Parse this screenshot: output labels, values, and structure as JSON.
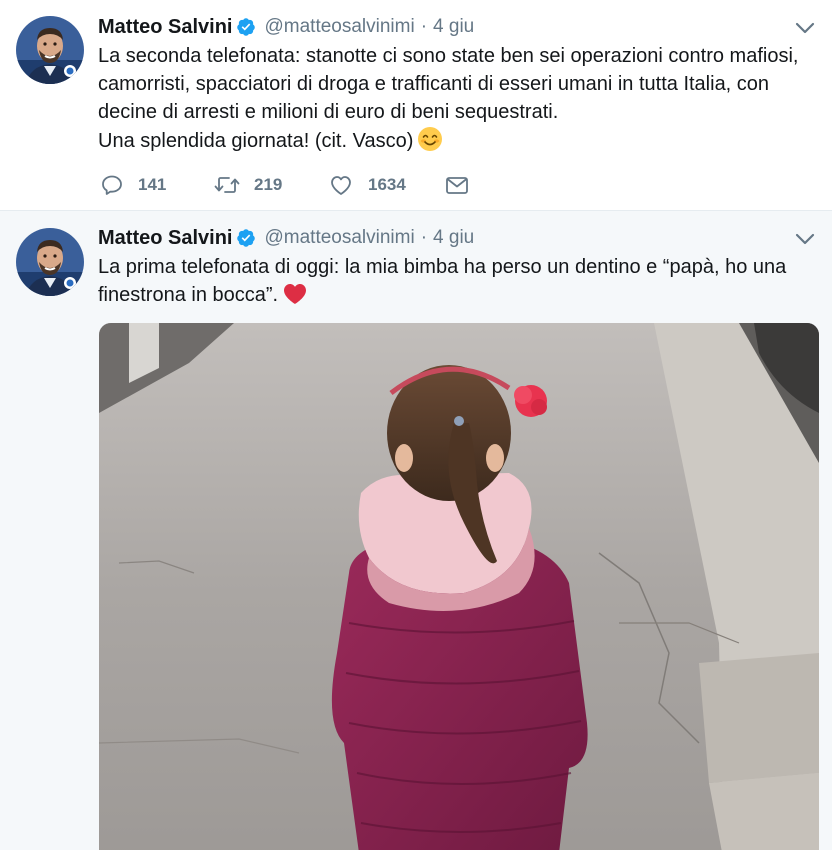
{
  "colors": {
    "accent": "#1da1f2",
    "text": "#14171a",
    "secondary": "#657786",
    "like": "#e0245e"
  },
  "tweets": [
    {
      "author": {
        "name": "Matteo Salvini",
        "handle": "@matteosalvinimi",
        "verified": true
      },
      "time": "4 giu",
      "text_lines": [
        "La seconda telefonata: stanotte ci sono state ben sei operazioni contro mafiosi,",
        "camorristi, spacciatori di droga e trafficanti di esseri umani in tutta Italia, con",
        "decine di arresti e milioni di euro di beni sequestrati.",
        "Una splendida giornata! (cit. Vasco)"
      ],
      "emoji": "smiling-face-icon",
      "counts": {
        "replies": "141",
        "retweets": "219",
        "likes": "1634"
      }
    },
    {
      "author": {
        "name": "Matteo Salvini",
        "handle": "@matteosalvinimi",
        "verified": true
      },
      "time": "4 giu",
      "text_lines": [
        "La prima telefonata di oggi: la mia bimba ha perso un dentino e “papà, ho una",
        "finestrona in bocca”."
      ],
      "emoji": "red-heart-icon",
      "media": "photo-child-on-street"
    }
  ]
}
